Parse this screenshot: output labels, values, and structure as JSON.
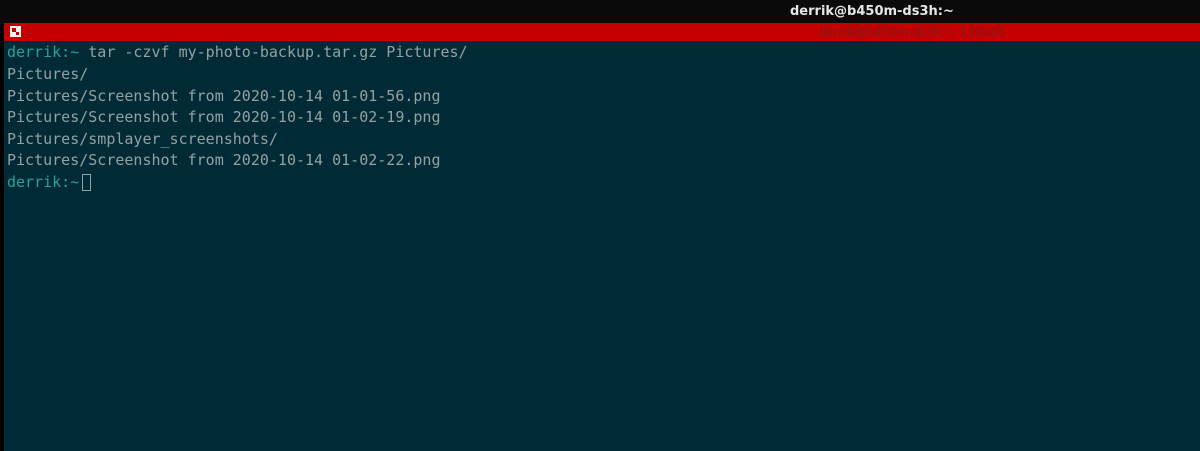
{
  "window": {
    "title": "derrik@b450m-ds3h:~"
  },
  "tab": {
    "label": "derrik@b450m-ds3h:~ 130x43",
    "icon": "terminal-tab-icon"
  },
  "colors": {
    "terminal_bg": "#002b36",
    "tab_bar": "#c40000",
    "prompt": "#2aa198",
    "text": "#93a1a1"
  },
  "terminal": {
    "prompt_user": "derrik:",
    "prompt_dir": "~",
    "command": "tar -czvf my-photo-backup.tar.gz Pictures/",
    "output": [
      "Pictures/",
      "Pictures/Screenshot from 2020-10-14 01-01-56.png",
      "Pictures/Screenshot from 2020-10-14 01-02-19.png",
      "Pictures/smplayer_screenshots/",
      "Pictures/Screenshot from 2020-10-14 01-02-22.png"
    ],
    "final_prompt_user": "derrik:",
    "final_prompt_dir": "~"
  }
}
